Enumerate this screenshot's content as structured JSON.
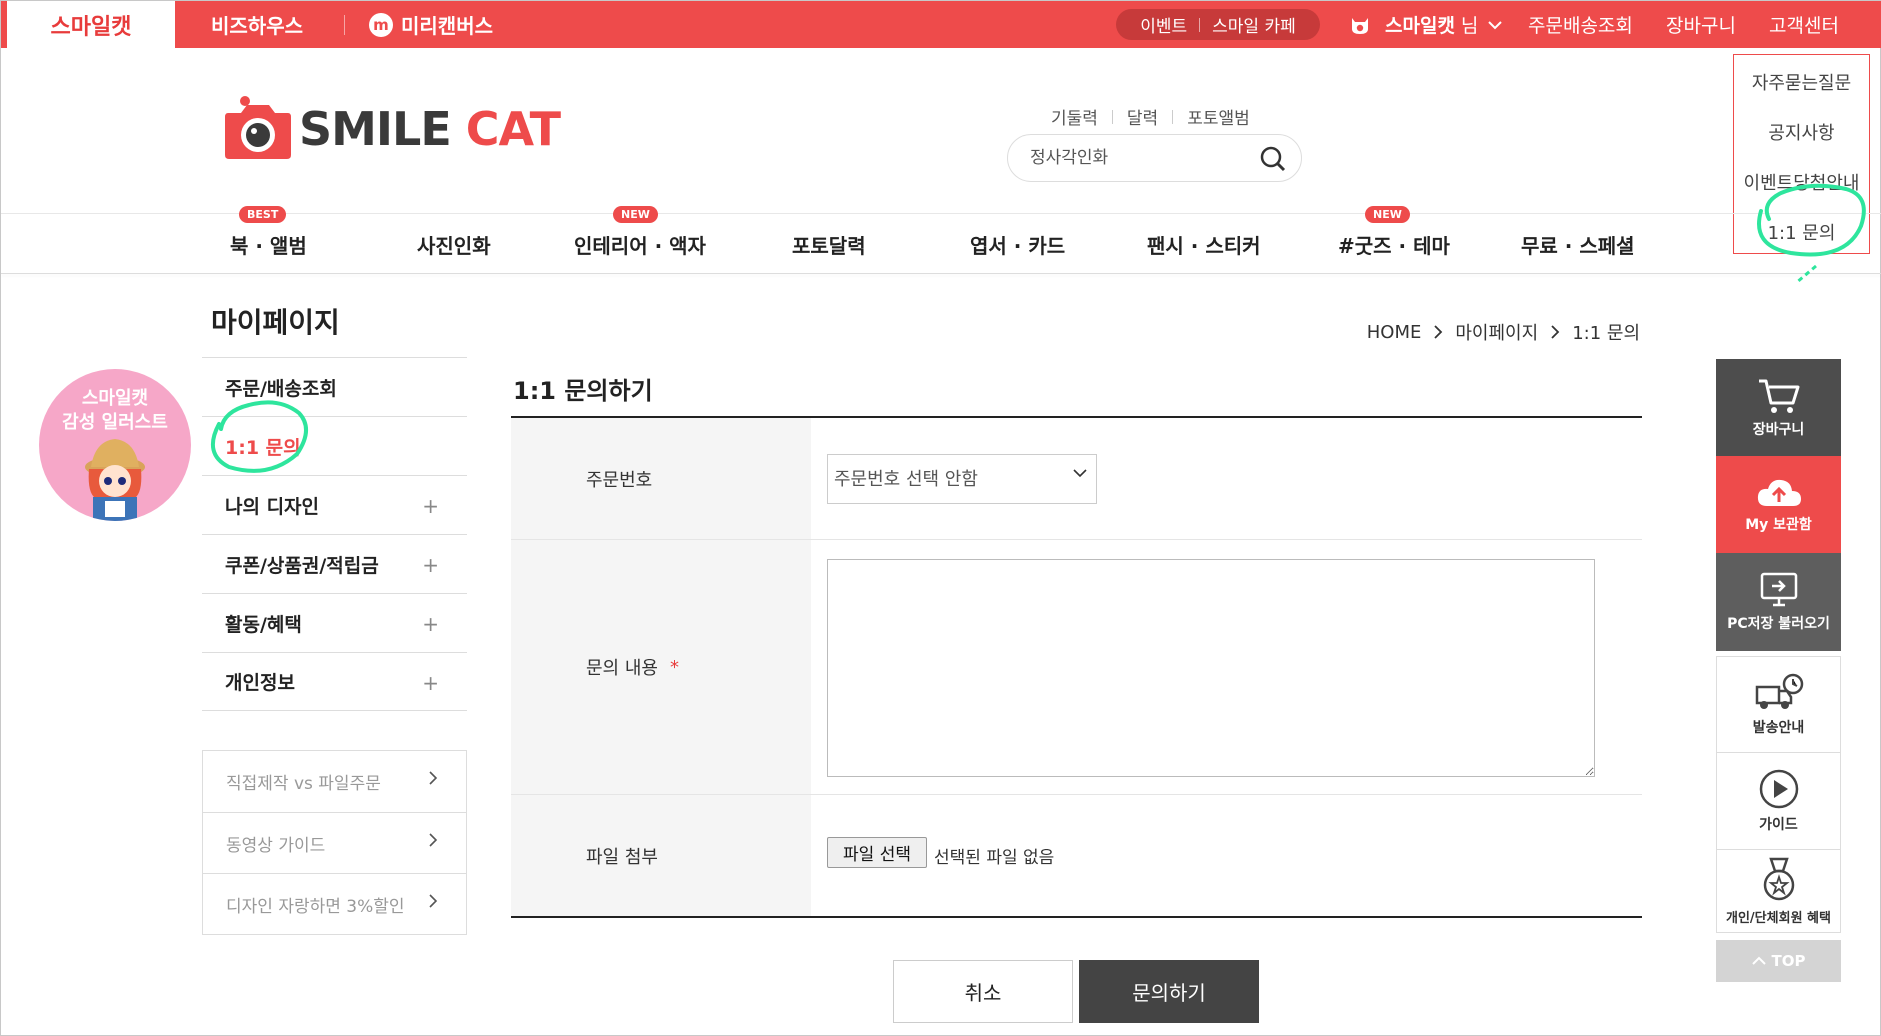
{
  "topbar": {
    "brand_tab": "스마일캣",
    "sites": [
      "비즈하우스",
      "미리캔버스"
    ],
    "miri_logo_letter": "m",
    "pill_links": [
      "이벤트",
      "스마일 카페"
    ],
    "user_name": "스마일캣",
    "user_suffix": "님",
    "links": [
      "주문배송조회",
      "장바구니",
      "고객센터"
    ]
  },
  "cs_dropdown": [
    "자주묻는질문",
    "공지사항",
    "이벤트당첨안내",
    "1:1 문의"
  ],
  "header": {
    "logo_part1": "SMILE",
    "logo_part2": "CAT",
    "quick_links": [
      "기둘력",
      "달력",
      "포토앨범"
    ],
    "search_placeholder": "정사각인화"
  },
  "nav": [
    {
      "label": "북 · 앨범",
      "badge": "BEST"
    },
    {
      "label": "사진인화",
      "badge": ""
    },
    {
      "label": "인테리어 · 액자",
      "badge": "NEW"
    },
    {
      "label": "포토달력",
      "badge": ""
    },
    {
      "label": "엽서 · 카드",
      "badge": ""
    },
    {
      "label": "팬시 · 스티커",
      "badge": ""
    },
    {
      "label": "#굿즈 · 테마",
      "badge": "NEW"
    },
    {
      "label": "무료 · 스페셜",
      "badge": ""
    }
  ],
  "page": {
    "title": "마이페이지",
    "breadcrumb": [
      "HOME",
      "마이페이지",
      "1:1 문의"
    ]
  },
  "promo": {
    "line1": "스마일캣",
    "line2": "감성 일러스트"
  },
  "side_menu": [
    {
      "label": "주문/배송조회",
      "plus": ""
    },
    {
      "label": "1:1 문의",
      "plus": ""
    },
    {
      "label": "나의 디자인",
      "plus": "+"
    },
    {
      "label": "쿠폰/상품권/적립금",
      "plus": "+"
    },
    {
      "label": "활동/혜택",
      "plus": "+"
    },
    {
      "label": "개인정보",
      "plus": "+"
    }
  ],
  "side_links": [
    "직접제작 vs 파일주문",
    "동영상 가이드",
    "디자인 자랑하면 3%할인"
  ],
  "form": {
    "title": "1:1 문의하기",
    "order_label": "주문번호",
    "order_select_value": "주문번호 선택 안함",
    "content_label": "문의 내용",
    "required_mark": "*",
    "file_label": "파일 첨부",
    "file_button": "파일 선택",
    "file_status": "선택된 파일 없음"
  },
  "buttons": {
    "cancel": "취소",
    "submit": "문의하기"
  },
  "quick_bar": [
    "장바구니",
    "My 보관함",
    "PC저장 불러오기",
    "발송안내",
    "가이드",
    "개인/단체회원 혜택",
    "TOP"
  ],
  "colors": {
    "brand_red": "#ee4b4b",
    "dark": "#444444",
    "annotation_green": "#2ee59d"
  }
}
